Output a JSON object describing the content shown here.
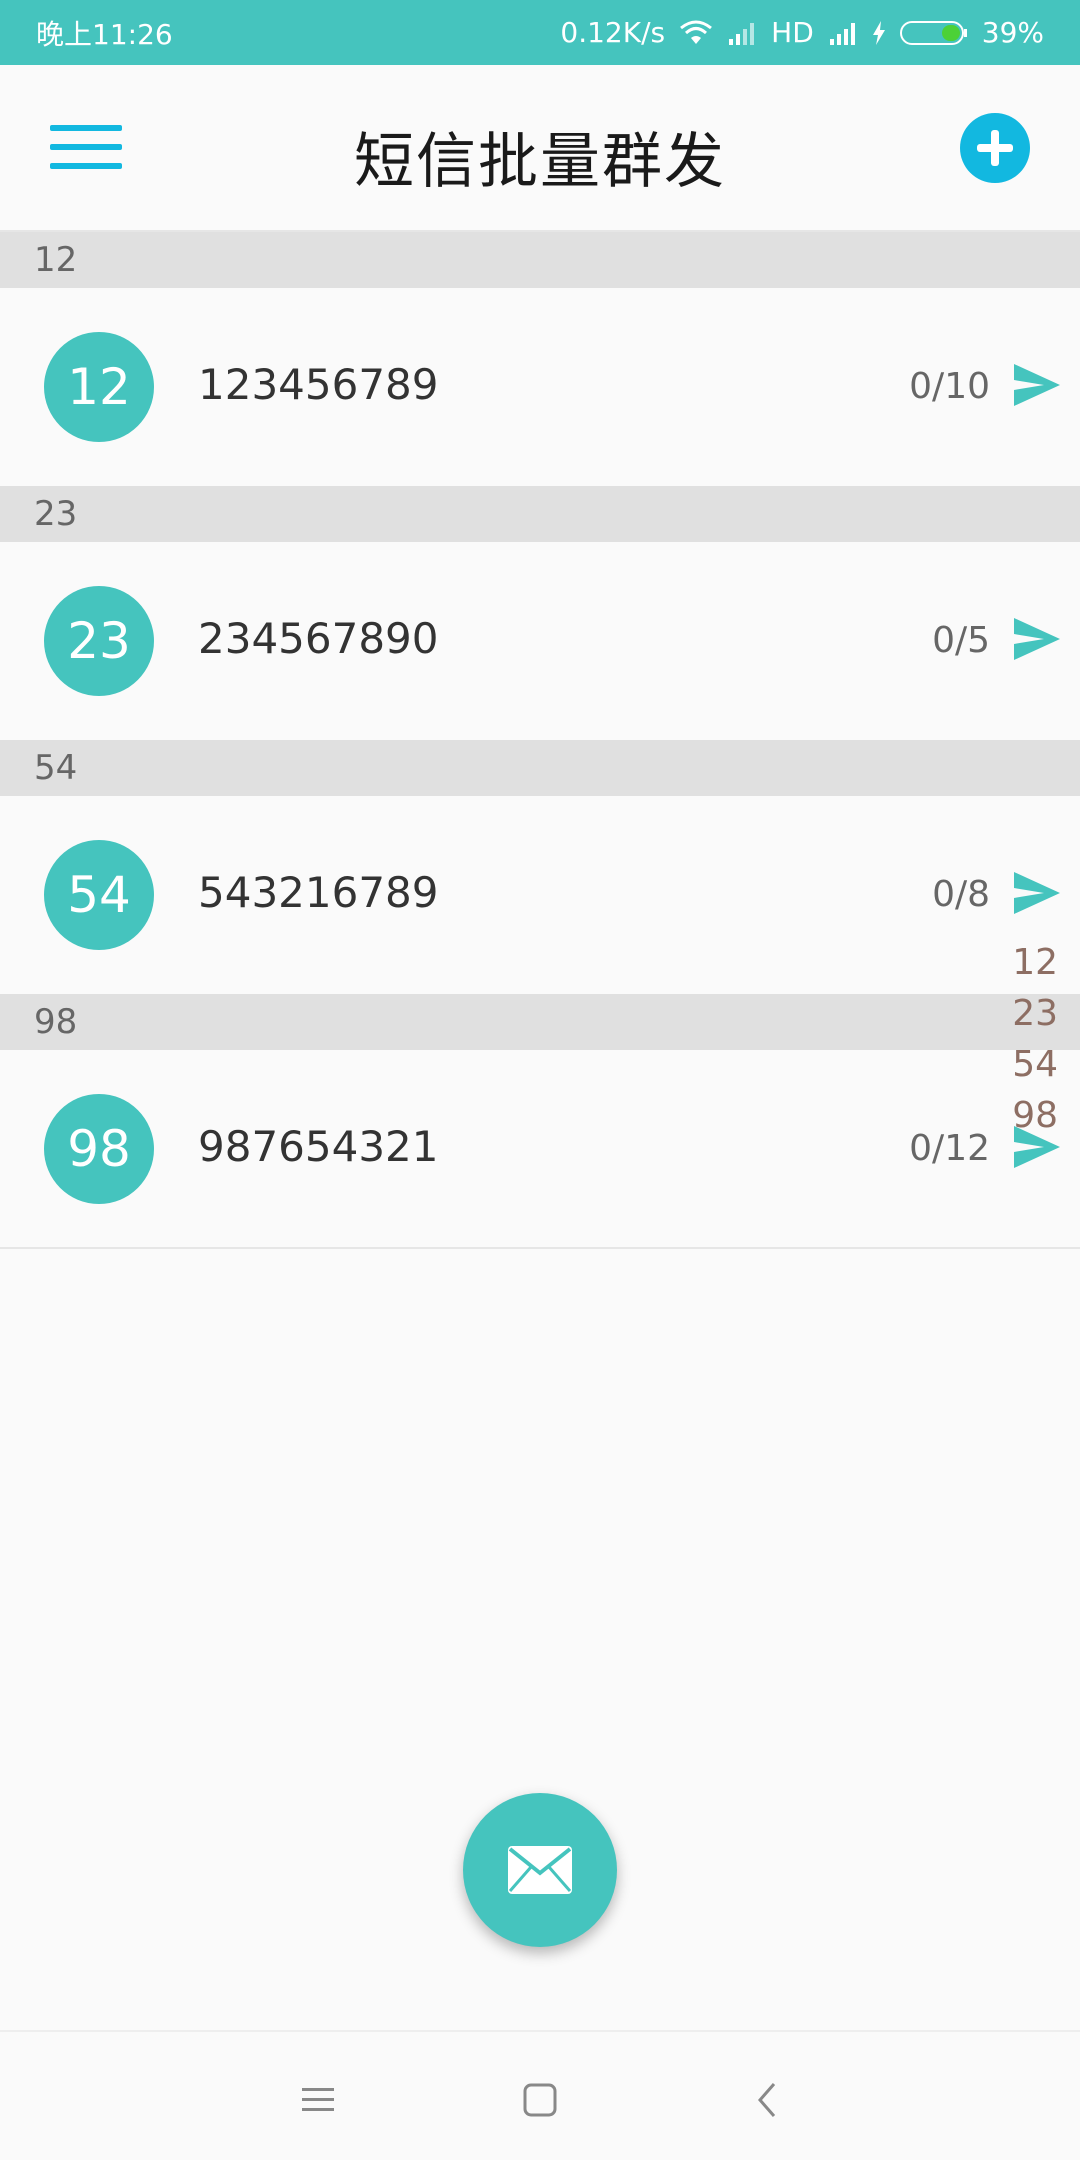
{
  "status_bar": {
    "time": "晚上11:26",
    "speed": "0.12K/s",
    "network": "HD",
    "battery": "39%"
  },
  "toolbar": {
    "title": "短信批量群发",
    "accent_color": "#12b8e0"
  },
  "groups": [
    {
      "header": "12",
      "avatar": "12",
      "phone": "123456789",
      "count": "0/10"
    },
    {
      "header": "23",
      "avatar": "23",
      "phone": "234567890",
      "count": "0/5"
    },
    {
      "header": "54",
      "avatar": "54",
      "phone": "543216789",
      "count": "0/8"
    },
    {
      "header": "98",
      "avatar": "98",
      "phone": "987654321",
      "count": "0/12"
    }
  ],
  "index_bar": [
    "12",
    "23",
    "54",
    "98"
  ],
  "colors": {
    "primary": "#45c4be",
    "index_text": "#8d6e63",
    "header_bg": "#e0e0e0"
  },
  "icons": {
    "menu": "menu-icon",
    "add": "add-icon",
    "send": "send-icon",
    "fab": "mail-icon"
  }
}
